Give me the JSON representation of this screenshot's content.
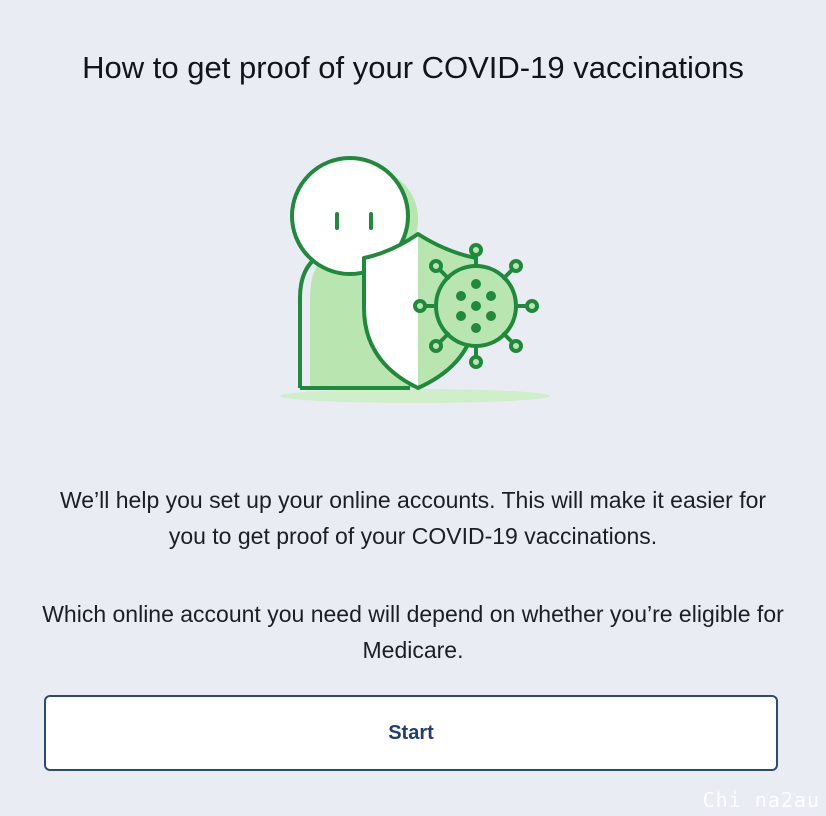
{
  "page": {
    "title": "How to get proof of your COVID-19 vaccinations",
    "paragraph_1": "We’ll help you set up your online accounts. This will make it easier for you to get proof of your COVID-19 vaccinations.",
    "paragraph_2": "Which online account you need will depend on whether you’re eligible for Medicare.",
    "start_button_label": "Start"
  },
  "illustration": {
    "icon": "person-with-shield-virus-icon",
    "colors": {
      "outline": "#1f8a3c",
      "fill_light": "#b9e6b0",
      "fill_white": "#ffffff",
      "shadow": "#cfeec9"
    }
  },
  "watermark": {
    "text": "Chi na2au"
  },
  "colors": {
    "background": "#e9edf3",
    "button_border": "#2c4a74",
    "button_text": "#1f3f6e"
  }
}
